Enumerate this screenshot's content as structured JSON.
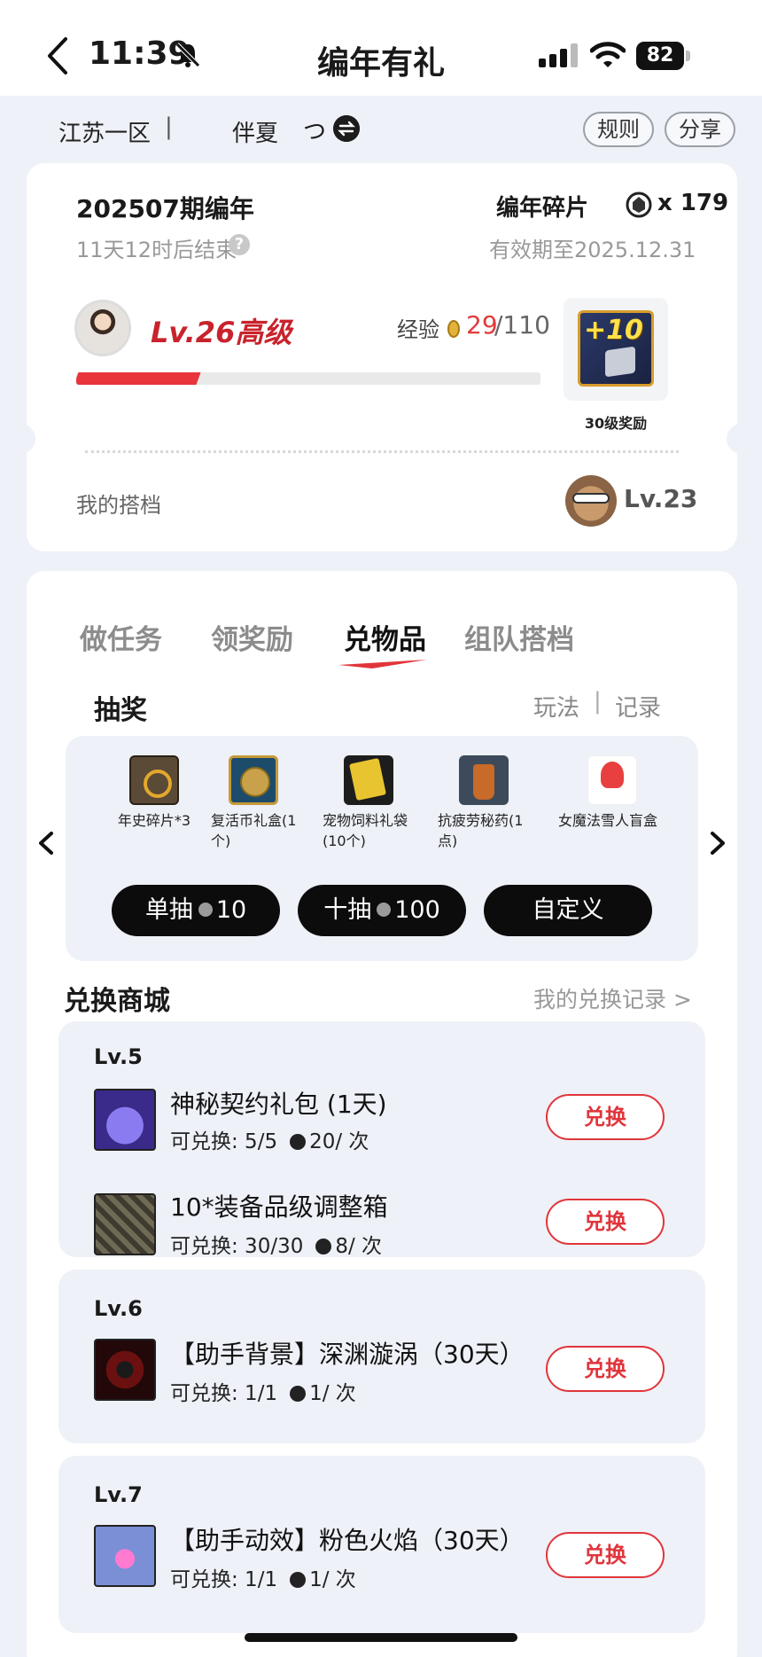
{
  "status_bar": {
    "time": "11:39",
    "battery": "82"
  },
  "nav": {
    "title": "编年有礼"
  },
  "server_row": {
    "server": "江苏一区",
    "separator": "|",
    "role": "伴夏",
    "role_symbol": "つ",
    "rules_label": "规则",
    "share_label": "分享"
  },
  "summary": {
    "period_title": "202507期编年",
    "ends_in": "11天12时后结束",
    "fragments_label": "编年碎片",
    "fragments_count": "x 179",
    "valid_until": "有效期至2025.12.31",
    "level_text": "Lv.26高级",
    "exp_label": "经验",
    "exp_current": "29",
    "exp_max": "/110",
    "exp_progress": 0.264,
    "reward_plus": "+10",
    "reward_label": "30级奖励",
    "partner_label": "我的搭档",
    "partner_level": "Lv.23"
  },
  "tabs": [
    {
      "label": "做任务",
      "active": false
    },
    {
      "label": "领奖励",
      "active": false
    },
    {
      "label": "兑物品",
      "active": true
    },
    {
      "label": "组队搭档",
      "active": false
    }
  ],
  "lottery": {
    "title": "抽奖",
    "play_link": "玩法",
    "link_separator": "|",
    "record_link": "记录",
    "prizes": [
      {
        "name": "年史碎片*3",
        "icon": "chronicle-fragment-icon"
      },
      {
        "name": "复活币礼盒(1个)",
        "icon": "revive-coin-box-icon"
      },
      {
        "name": "宠物饲料礼袋(10个)",
        "icon": "pet-feed-bag-icon"
      },
      {
        "name": "抗疲劳秘药(1点)",
        "icon": "fatigue-potion-icon"
      },
      {
        "name": "女魔法雪人盲盒",
        "icon": "snowman-blind-box-icon"
      }
    ],
    "single_label": "单抽",
    "single_cost": "10",
    "ten_label": "十抽",
    "ten_cost": "100",
    "custom_label": "自定义"
  },
  "shop": {
    "title": "兑换商城",
    "history_link": "我的兑换记录 >",
    "redeem_label": "兑换",
    "groups": [
      {
        "level": "Lv.5",
        "items": [
          {
            "name": "神秘契约礼包 (1天)",
            "limit": "可兑换: 5/5",
            "cost": "20/ 次"
          },
          {
            "name": "10*装备品级调整箱",
            "limit": "可兑换: 30/30",
            "cost": "8/ 次"
          }
        ]
      },
      {
        "level": "Lv.6",
        "items": [
          {
            "name": "【助手背景】深渊漩涡（30天）",
            "limit": "可兑换: 1/1",
            "cost": "1/ 次"
          }
        ]
      },
      {
        "level": "Lv.7",
        "items": [
          {
            "name": "【助手动效】粉色火焰（30天）",
            "limit": "可兑换: 1/1",
            "cost": "1/ 次"
          }
        ]
      }
    ]
  }
}
